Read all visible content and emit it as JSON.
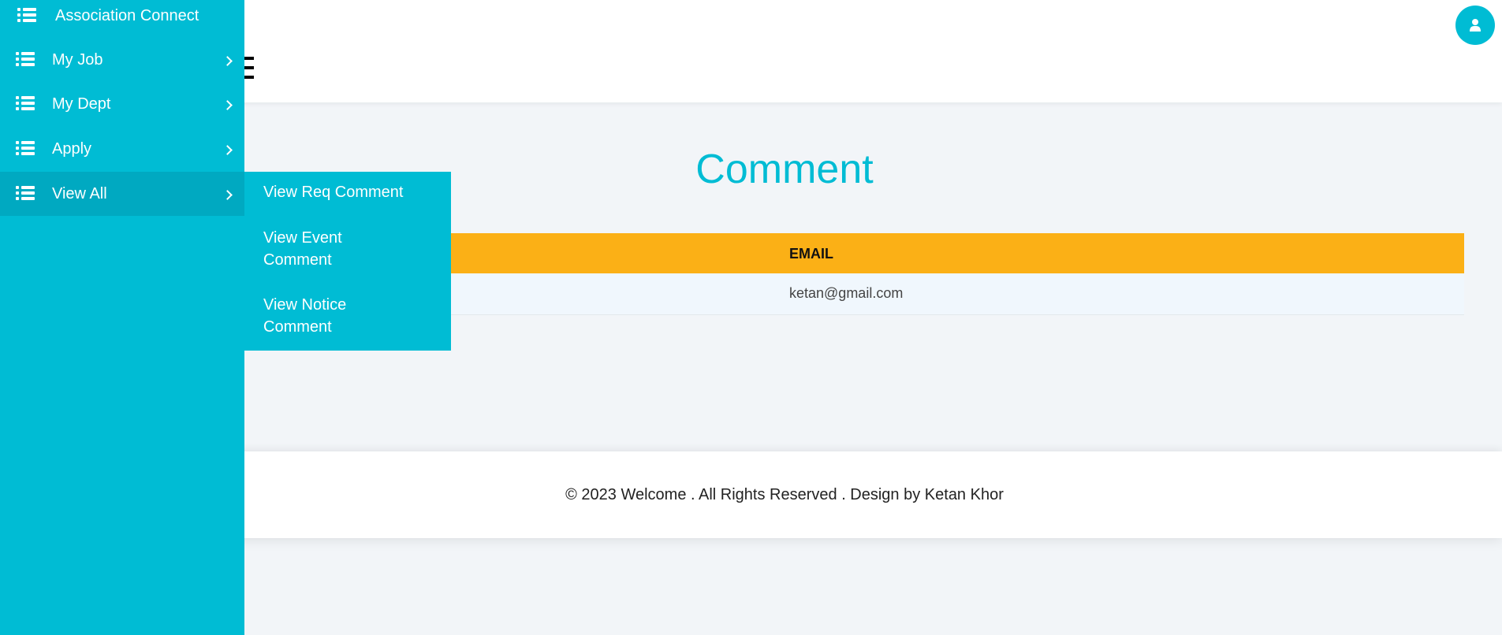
{
  "app": {
    "brand_name": "Association Connect"
  },
  "colors": {
    "accent": "#00bcd4",
    "table_header": "#fbb016"
  },
  "sidebar": {
    "items": [
      {
        "label": "My Job",
        "icon": "list-icon"
      },
      {
        "label": "My Dept",
        "icon": "list-icon"
      },
      {
        "label": "Apply",
        "icon": "list-icon"
      },
      {
        "label": "View All",
        "icon": "list-icon",
        "active": true
      }
    ]
  },
  "submenu": {
    "items": [
      {
        "label": "View Req Comment"
      },
      {
        "label": "View Event Comment"
      },
      {
        "label": "View Notice Comment"
      }
    ]
  },
  "header": {
    "menu_icon": "hamburger-icon",
    "user_icon": "user-icon"
  },
  "main": {
    "title": "Comment",
    "table": {
      "columns": [
        "EMAIL"
      ],
      "rows": [
        {
          "email": "ketan@gmail.com"
        }
      ]
    }
  },
  "footer": {
    "text": "© 2023 Welcome . All Rights Reserved . Design by Ketan Khor"
  }
}
